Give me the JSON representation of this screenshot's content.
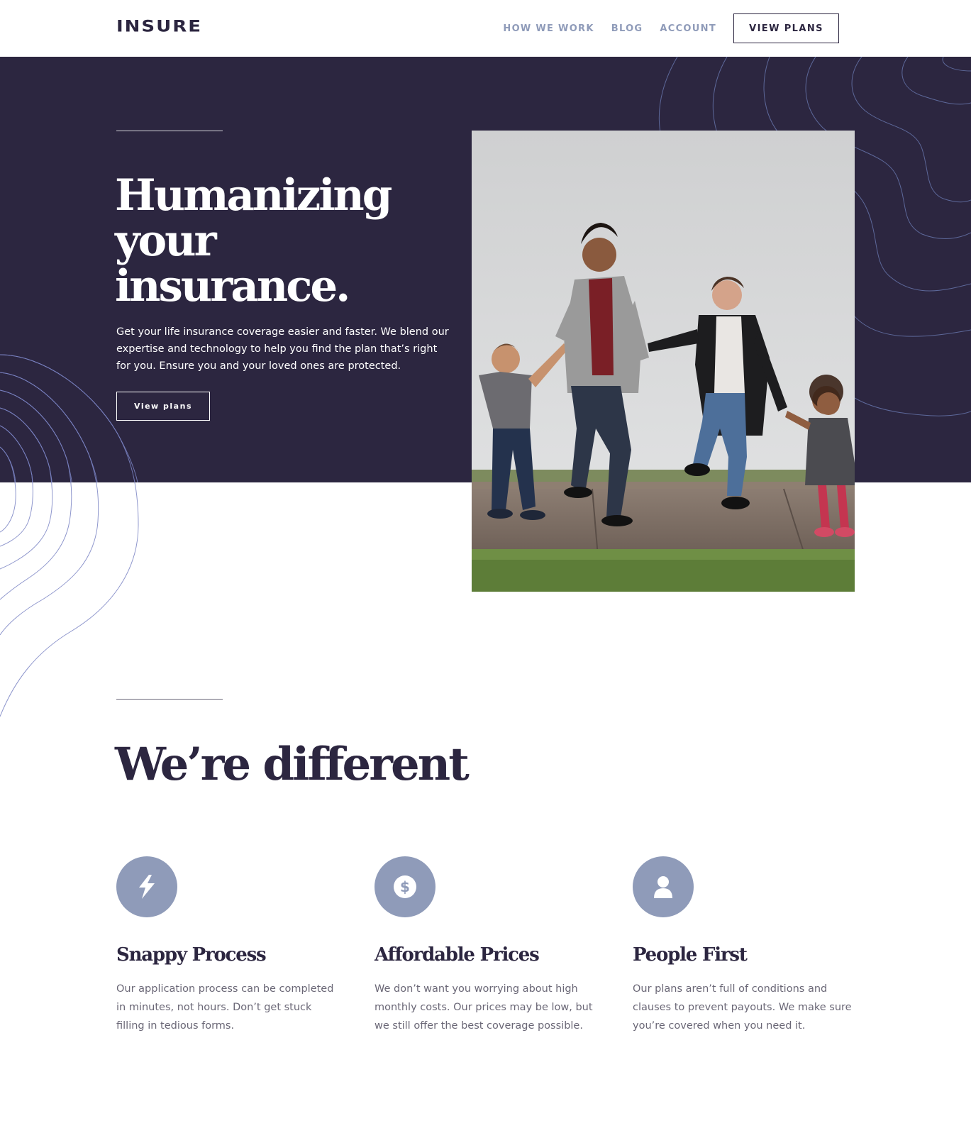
{
  "header": {
    "logo": "INSURE",
    "nav": [
      "HOW WE WORK",
      "BLOG",
      "ACCOUNT"
    ],
    "cta": "VIEW PLANS"
  },
  "hero": {
    "title_lines": [
      "Humanizing",
      "your",
      "insurance."
    ],
    "text": "Get your life insurance coverage easier and faster. We blend our expertise and technology to help you find the plan that’s right for you. Ensure you and your loved ones are protected.",
    "button": "View plans"
  },
  "features_section": {
    "title": "We’re different",
    "items": [
      {
        "icon": "lightning-icon",
        "title": "Snappy Process",
        "text": "Our application process can be completed in minutes, not hours. Don’t get stuck filling in tedious forms."
      },
      {
        "icon": "dollar-icon",
        "title": "Affordable Prices",
        "text": "We don’t want you worrying about high monthly costs. Our prices may be low, but we still offer the best coverage possible."
      },
      {
        "icon": "person-icon",
        "title": "People First",
        "text": "Our plans aren’t full of conditions and clauses to prevent payouts. We make sure you’re covered when you need it."
      }
    ]
  },
  "colors": {
    "dark_violet": "#2c2640",
    "grayish_blue": "#8f9bb9",
    "white": "#ffffff"
  }
}
